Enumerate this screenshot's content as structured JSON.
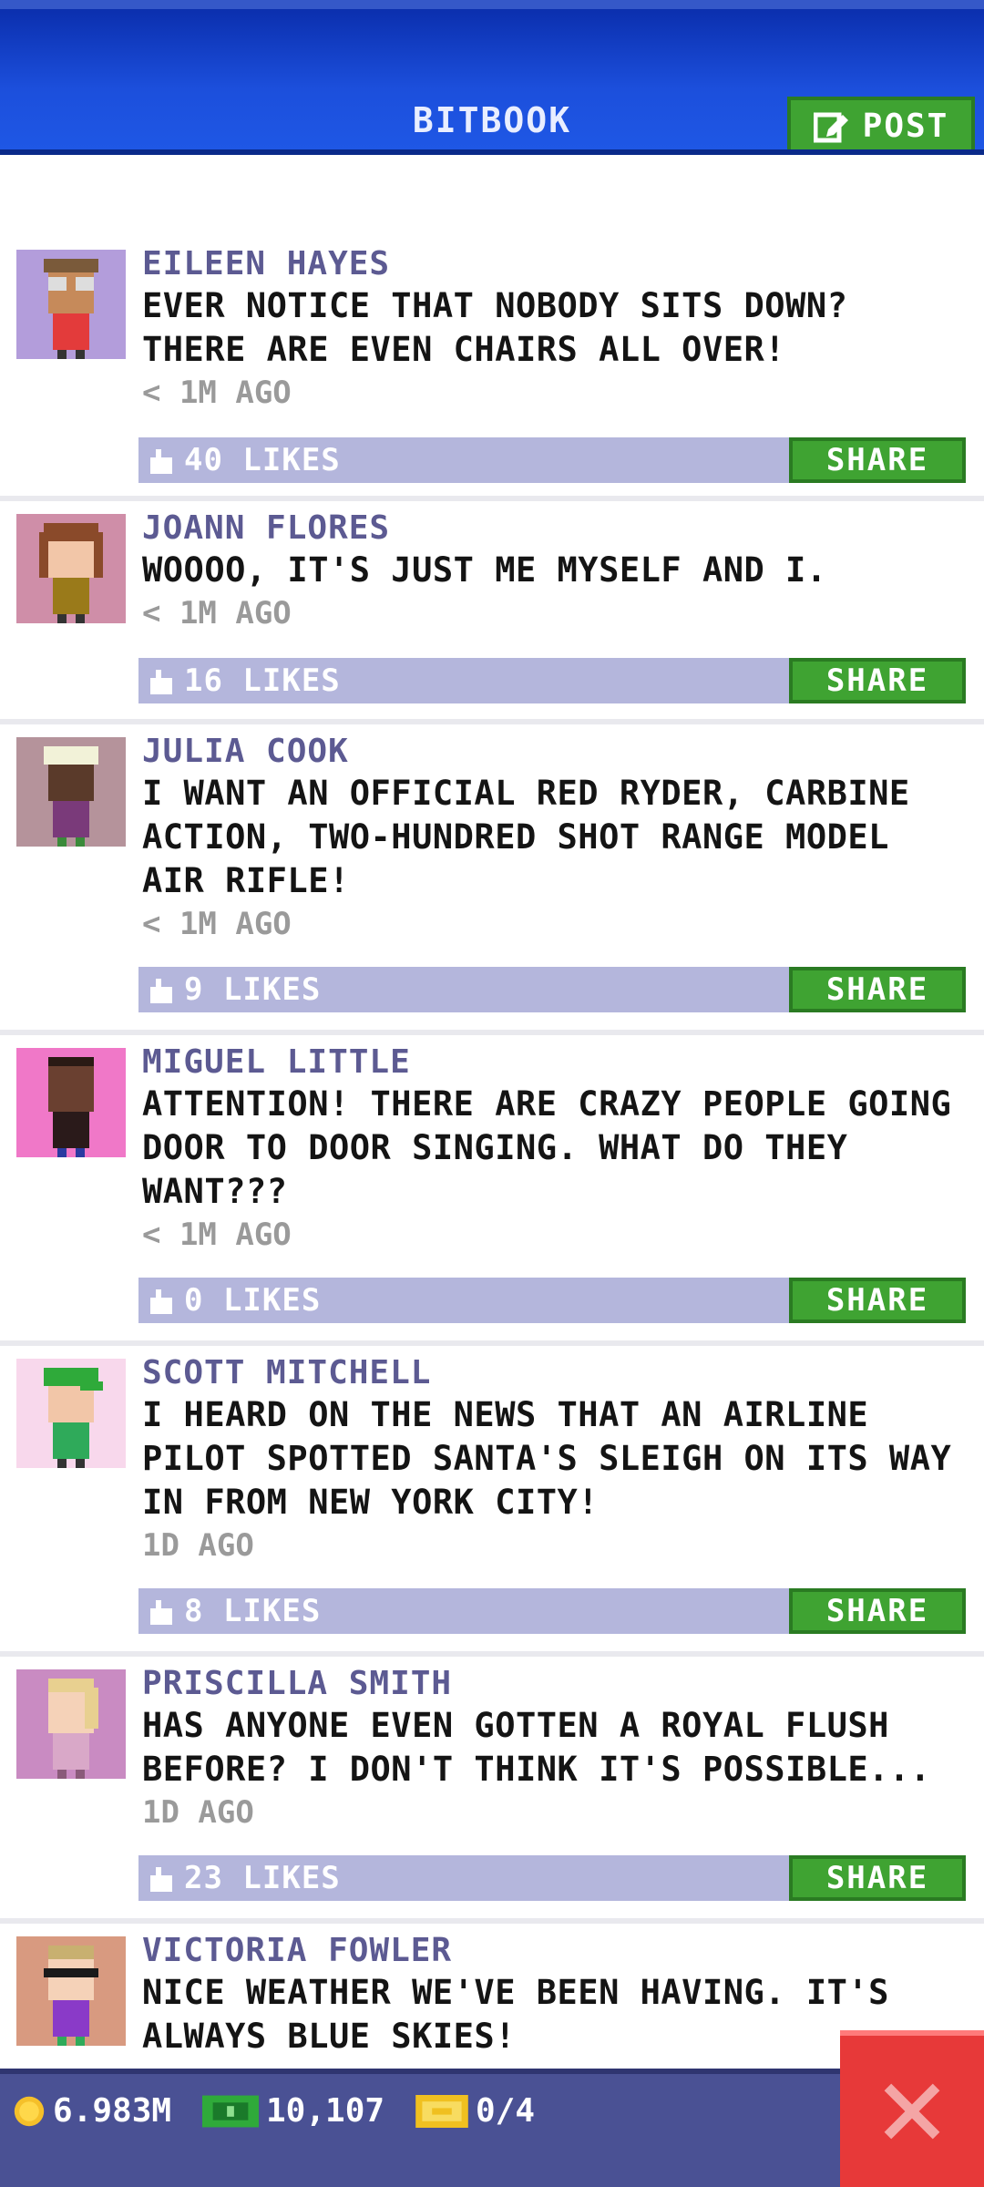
{
  "header": {
    "title": "BITBOOK",
    "post_label": "POST"
  },
  "posts": [
    {
      "name": "EILEEN HAYES",
      "message": "EVER NOTICE THAT NOBODY SITS DOWN? THERE ARE EVEN CHAIRS ALL OVER!",
      "time": "< 1M AGO",
      "likes": "40 LIKES",
      "share": "SHARE",
      "avatar_bg": "#b39ddb"
    },
    {
      "name": "JOANN FLORES",
      "message": "WOOOO, IT'S JUST ME MYSELF AND I.",
      "time": "< 1M AGO",
      "likes": "16 LIKES",
      "share": "SHARE",
      "avatar_bg": "#cf8ea8"
    },
    {
      "name": "JULIA COOK",
      "message": "I WANT AN OFFICIAL RED RYDER, CARBINE ACTION, TWO-HUNDRED SHOT RANGE MODEL AIR RIFLE!",
      "time": "< 1M AGO",
      "likes": "9 LIKES",
      "share": "SHARE",
      "avatar_bg": "#b5939b"
    },
    {
      "name": "MIGUEL LITTLE",
      "message": "ATTENTION! THERE ARE CRAZY PEOPLE GOING DOOR TO DOOR SINGING. WHAT DO THEY WANT???",
      "time": "< 1M AGO",
      "likes": "0 LIKES",
      "share": "SHARE",
      "avatar_bg": "#f078c8"
    },
    {
      "name": "SCOTT MITCHELL",
      "message": "I HEARD ON THE NEWS THAT AN AIRLINE PILOT SPOTTED SANTA'S SLEIGH ON ITS WAY IN FROM NEW YORK CITY!",
      "time": "1D AGO",
      "likes": "8 LIKES",
      "share": "SHARE",
      "avatar_bg": "#f8d8ec"
    },
    {
      "name": "PRISCILLA SMITH",
      "message": "HAS ANYONE EVEN GOTTEN A ROYAL FLUSH BEFORE? I DON'T THINK IT'S POSSIBLE...",
      "time": "1D AGO",
      "likes": "23 LIKES",
      "share": "SHARE",
      "avatar_bg": "#c98bc2"
    },
    {
      "name": "VICTORIA FOWLER",
      "message": "NICE WEATHER WE'VE BEEN HAVING. IT'S ALWAYS BLUE SKIES!",
      "time": "",
      "likes": "",
      "share": "",
      "avatar_bg": "#d89a80"
    }
  ],
  "bottom": {
    "coins": "6.983M",
    "bux": "10,107",
    "tickets": "0/4"
  },
  "colors": {
    "header": "#1c4fdc",
    "share_green": "#3fa332",
    "likes_bar": "#b4b6dc",
    "close_red": "#e73939"
  }
}
